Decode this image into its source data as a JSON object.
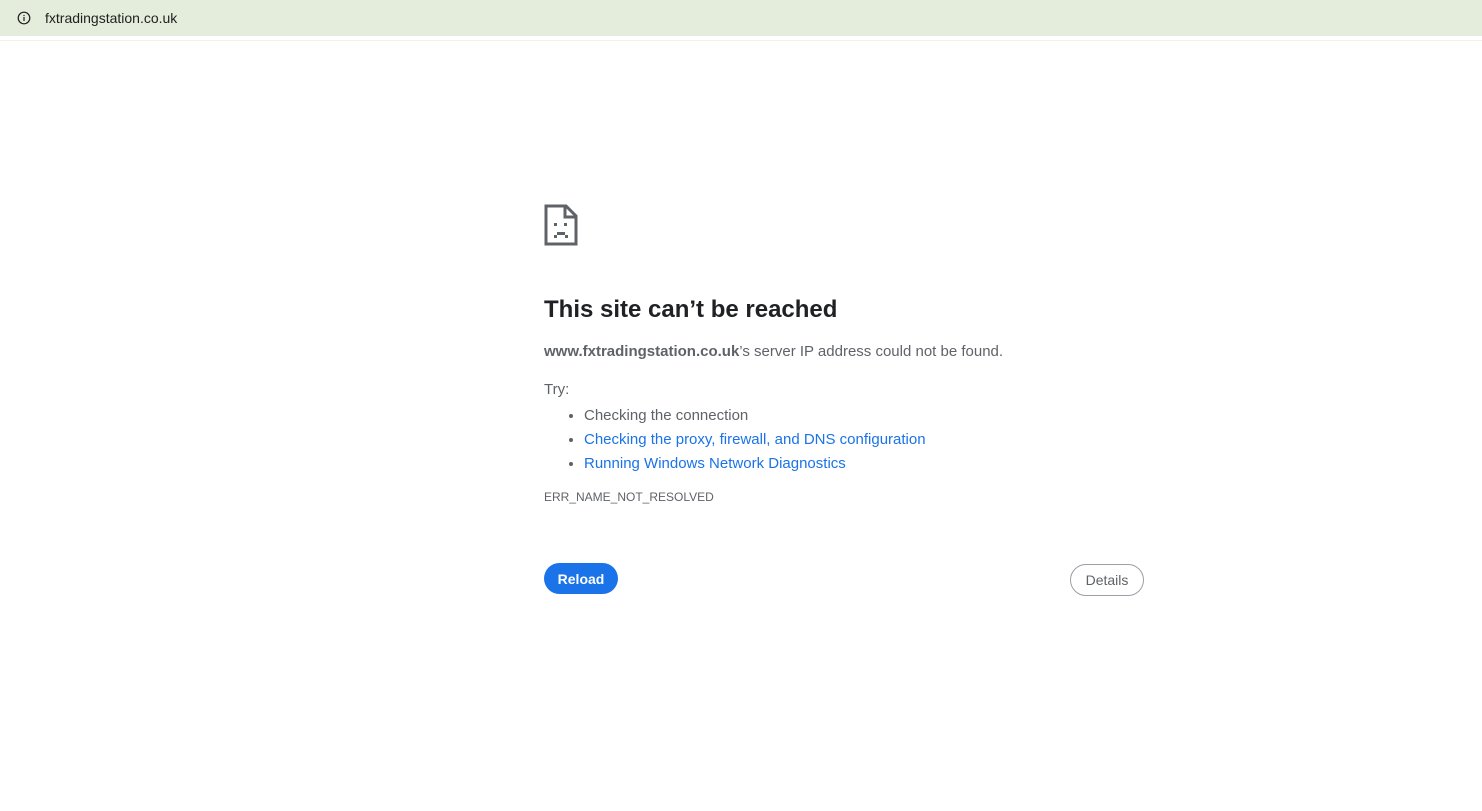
{
  "address_bar": {
    "url": "fxtradingstation.co.uk",
    "site_info_icon": "info-circle-icon"
  },
  "error": {
    "icon": "sad-document-icon",
    "title": "This site can’t be reached",
    "host": "www.fxtradingstation.co.uk",
    "description_suffix": "’s server IP address could not be found.",
    "try_label": "Try:",
    "suggestions": [
      {
        "text": "Checking the connection",
        "link": false
      },
      {
        "text": "Checking the proxy, firewall, and DNS configuration",
        "link": true
      },
      {
        "text": "Running Windows Network Diagnostics",
        "link": true
      }
    ],
    "code": "ERR_NAME_NOT_RESOLVED"
  },
  "buttons": {
    "reload_label": "Reload",
    "details_label": "Details"
  },
  "colors": {
    "toolbar_bg": "#e4eddb",
    "primary": "#1a73e8",
    "text": "#5f6368",
    "heading": "#202124"
  }
}
